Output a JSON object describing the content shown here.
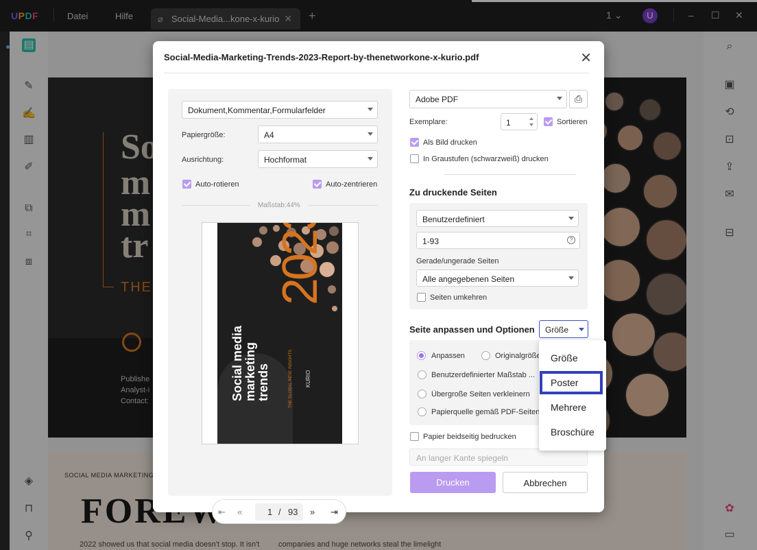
{
  "app": {
    "logo": "UPDF",
    "menu": [
      "Datei",
      "Hilfe"
    ],
    "tab_title": "Social-Media...kone-x-kurio",
    "page_indicator": "1",
    "user_initial": "U"
  },
  "document": {
    "cover_lines": [
      "So",
      "m",
      "m",
      "tr"
    ],
    "cover_the": "THE",
    "cover_small": [
      "Publishe",
      "Analyst-i",
      "Contact:"
    ],
    "page2_header": "SOCIAL MEDIA MARKETING T",
    "page2_title": "FOREWORD",
    "page2_body_left": "2022 showed us that social media doesn't stop. It isn't",
    "page2_body_right": "companies and huge networks steal the limelight"
  },
  "dialog": {
    "title": "Social-Media-Marketing-Trends-2023-Report-by-thenetworkone-x-kurio.pdf",
    "left": {
      "content_select": "Dokument,Kommentar,Formularfelder",
      "paper_size_label": "Papiergröße:",
      "paper_size_value": "A4",
      "orientation_label": "Ausrichtung:",
      "orientation_value": "Hochformat",
      "auto_rotate": "Auto-rotieren",
      "auto_center": "Auto-zentrieren",
      "scale_label": "Maßstab:44%",
      "preview": {
        "year": "2023",
        "title": "Social media marketing trends",
        "subtitle": "THE GLOBAL INDIE INSIGHTS",
        "brand": "KURIO"
      },
      "pager": {
        "current": "1",
        "sep": "/",
        "total": "93"
      }
    },
    "right": {
      "printer": "Adobe PDF",
      "copies_label": "Exemplare:",
      "copies_value": "1",
      "collate": "Sortieren",
      "print_as_image": "Als Bild drucken",
      "grayscale": "In Graustufen (schwarzweiß) drucken",
      "pages_heading": "Zu druckende Seiten",
      "pages_mode": "Benutzerdefiniert",
      "pages_range": "1-93",
      "odd_even_label": "Gerade/ungerade Seiten",
      "odd_even_value": "Alle angegebenen Seiten",
      "reverse": "Seiten umkehren",
      "fit_heading": "Seite anpassen und Optionen",
      "fit_mode": "Größe",
      "options": [
        "Anpassen",
        "Originalgröße",
        "Benutzerdefinierter Maßstab ...",
        "Übergroße Seiten verkleinern",
        "Papierquelle gemäß PDF-Seitengröße"
      ],
      "duplex": "Papier beidseitig bedrucken",
      "mirror": "An langer Kante spiegeln",
      "print_button": "Drucken",
      "cancel_button": "Abbrechen"
    },
    "fit_dropdown": [
      "Größe",
      "Poster",
      "Mehrere",
      "Broschüre"
    ],
    "fit_dropdown_highlighted": "Poster"
  },
  "colors": {
    "accent": "#b99cf0",
    "highlight": "#3340b8",
    "cover_orange": "#d6741f"
  }
}
